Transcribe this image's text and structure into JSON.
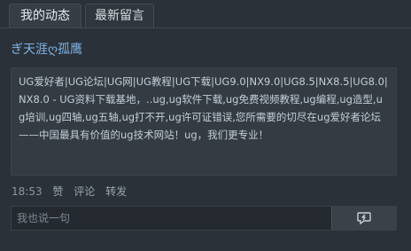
{
  "tabs": [
    {
      "label": "我的动态",
      "active": true
    },
    {
      "label": "最新留言",
      "active": false
    }
  ],
  "post": {
    "author": "ぎ天涯ღ孤鹰",
    "text": "UG爱好者|UG论坛|UG网|UG教程|UG下载|UG9.0|NX9.0|UG8.5|NX8.5|UG8.0|NX8.0 - UG资料下载基地，..ug,ug软件下载,ug免费视频教程,ug编程,ug造型,ug培训,ug四轴,ug五轴,ug打不开,ug许可证错误,您所需要的切尽在ug爱好者论坛——中国最具有价值的ug技术网站！ug，我们更专业！",
    "time": "18:53",
    "actions": {
      "like": "赞",
      "comment": "评论",
      "forward": "转发"
    }
  },
  "reply": {
    "placeholder": "我也说一句",
    "send_icon": "send-icon"
  },
  "colors": {
    "background": "#2b3138",
    "author": "#7fb3e6",
    "post_bg": "#343b43"
  }
}
